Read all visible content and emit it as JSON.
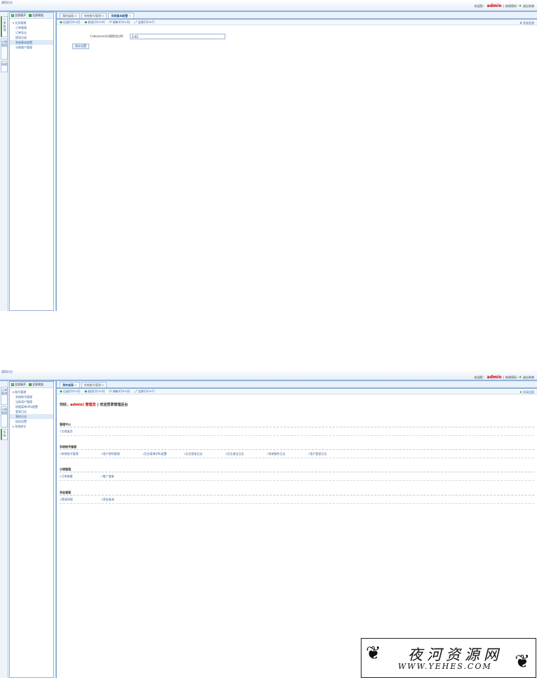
{
  "app": {
    "logo": "通用后台",
    "welcome_prefix": "欢迎您：",
    "user": "admin",
    "modify_pwd": "修改密码",
    "logout": "退出系统"
  },
  "vtabs": [
    "订单管理",
    "分销管理",
    "系统"
  ],
  "left_toolbar": {
    "expand_all": "全部展开",
    "collapse_all": "全部收起"
  },
  "screen1": {
    "tree": {
      "group": "业务管理",
      "items": [
        "订单管理",
        "订单导出",
        "提现记录",
        "系统基本配置",
        "分销商户管理"
      ],
      "active_index": 3
    },
    "tabs": [
      {
        "label": "我的桌面"
      },
      {
        "label": "系统账号管理"
      },
      {
        "label": "系统基本配置"
      }
    ],
    "form": {
      "label": "Cabeyound分佣提成比例：",
      "value": "0.02",
      "save": "保存设置"
    }
  },
  "toolbar": {
    "back": "后退(Ctrl+Z)",
    "forward": "前进(Ctrl+X)",
    "refresh": "刷新(Ctrl+Q)",
    "fullscreen": "全屏(Ctrl+F)",
    "close_all": "关闭全部"
  },
  "screen2": {
    "tree": {
      "group": "账号管理",
      "items": [
        "系统账号管理",
        "当前用户管理",
        "权限菜单URL配置",
        "登录日志",
        "我的日志",
        "短信设置"
      ],
      "active_index": 4,
      "group2": "系统其它"
    },
    "tabs": [
      {
        "label": "我的桌面"
      },
      {
        "label": "系统账号管理"
      }
    ],
    "welcome": {
      "prefix": "你好，",
      "user": "admin",
      "role": "( 管理员 )",
      "suffix": " 欢迎登录管理后台"
    },
    "sections": [
      {
        "title": "管理中心",
        "links": [
          "√主框架页"
        ]
      },
      {
        "title": "系统账号管理",
        "links": [
          "√系统账号管理",
          "√用户密码管理",
          "√后台菜单URL配置",
          "√后台登录日志",
          "√后台退出日志",
          "√系统操作日志",
          "√用户登录日志"
        ]
      },
      {
        "title": "分销管理",
        "links": [
          "√订单查看",
          "√推广链接"
        ]
      },
      {
        "title": "资金管理",
        "links": [
          "√提现明细",
          "√资金查询"
        ]
      }
    ]
  },
  "watermark": {
    "cn": "夜河资源网",
    "en": "WWW.YEHES.COM"
  }
}
